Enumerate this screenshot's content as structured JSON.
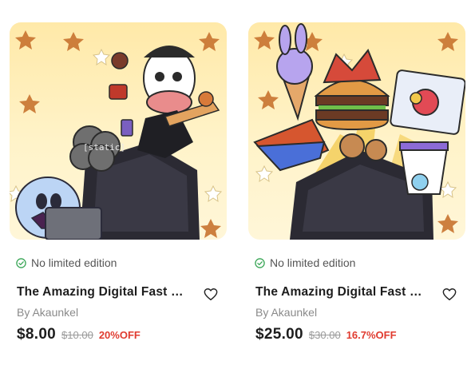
{
  "products": [
    {
      "edition": "No limited edition",
      "title": "The Amazing Digital Fast F...",
      "author": "By Akaunkel",
      "price": "$8.00",
      "original_price": "$10.00",
      "discount": "20%OFF",
      "art_text": "[static]"
    },
    {
      "edition": "No limited edition",
      "title": "The Amazing Digital Fast F...",
      "author": "By Akaunkel",
      "price": "$25.00",
      "original_price": "$30.00",
      "discount": "16.7%OFF"
    }
  ],
  "colors": {
    "discount": "#e03b2f",
    "edition_check": "#3aa657",
    "art_background": "#ffeeb5"
  },
  "icons": {
    "edition": "check-circle-icon",
    "favorite": "heart-outline-icon"
  }
}
